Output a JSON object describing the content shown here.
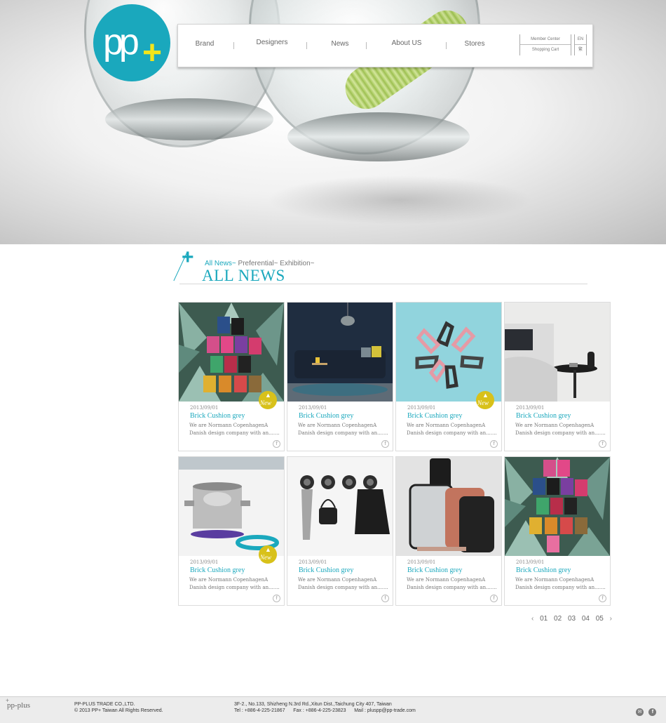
{
  "brand": {
    "logo_text": "pp",
    "logo_plus": "+"
  },
  "nav": {
    "items": [
      {
        "label": "Brand"
      },
      {
        "label": "Designers"
      },
      {
        "label": "News"
      },
      {
        "label": "About US"
      },
      {
        "label": "Stores"
      }
    ],
    "member_center": "Member Center",
    "shopping_cart": "Shopping Cart",
    "lang_en": "EN",
    "lang_zh": "繁"
  },
  "section": {
    "plus": "+",
    "filters": [
      "All News~",
      "Preferential~",
      "Exhibition~"
    ],
    "title": "ALL NEWS"
  },
  "cards": [
    {
      "date": "2013/09/01",
      "title": "Brick Cushion grey",
      "desc1": "We are Normann CopenhagenA",
      "desc2": "Danish design company with an.......",
      "new": true,
      "image": "tea-packs"
    },
    {
      "date": "2013/09/01",
      "title": "Brick Cushion grey",
      "desc1": "We are Normann CopenhagenA",
      "desc2": "Danish design company with an.......",
      "new": false,
      "image": "sofa-room"
    },
    {
      "date": "2013/09/01",
      "title": "Brick Cushion grey",
      "desc1": "We are Normann CopenhagenA",
      "desc2": "Danish design company with an.......",
      "new": true,
      "image": "peelers"
    },
    {
      "date": "2013/09/01",
      "title": "Brick Cushion grey",
      "desc1": "We are Normann CopenhagenA",
      "desc2": "Danish design company with an.......",
      "new": false,
      "image": "bedside-table"
    },
    {
      "date": "2013/09/01",
      "title": "Brick Cushion grey",
      "desc1": "We are Normann CopenhagenA",
      "desc2": "Danish design company with an.......",
      "new": true,
      "image": "cooking-pot"
    },
    {
      "date": "2013/09/01",
      "title": "Brick Cushion grey",
      "desc1": "We are Normann CopenhagenA",
      "desc2": "Danish design company with an.......",
      "new": false,
      "image": "wall-hooks"
    },
    {
      "date": "2013/09/01",
      "title": "Brick Cushion grey",
      "desc1": "We are Normann CopenhagenA",
      "desc2": "Danish design company with an.......",
      "new": false,
      "image": "phone-mirror"
    },
    {
      "date": "2013/09/01",
      "title": "Brick Cushion grey",
      "desc1": "We are Normann CopenhagenA",
      "desc2": "Danish design company with an.......",
      "new": false,
      "image": "tea-packs"
    }
  ],
  "badge_text": "New",
  "fb_glyph": "f",
  "pager": {
    "prev": "‹",
    "pages": [
      "01",
      "02",
      "03",
      "04",
      "05"
    ],
    "next": "›"
  },
  "footer": {
    "logo": "pp-plus",
    "company": "PP-PLUS TRADE CO.,LTD.",
    "copyright": "© 2013 PP+ Taiwan All Rights Reserved.",
    "address": "3F-2., No.133, Shizheng N.3rd Rd.,Xitun Dist.,Taichung City 407, Taiwan",
    "contact": "Tel : +886-4-225-21867      Fax : +886-4-225-23823      Mail : pluspp@pp-trade.com"
  },
  "colors": {
    "accent": "#1aa8bd",
    "logo_plus": "#f3e51a",
    "badge": "#d8c11a"
  }
}
